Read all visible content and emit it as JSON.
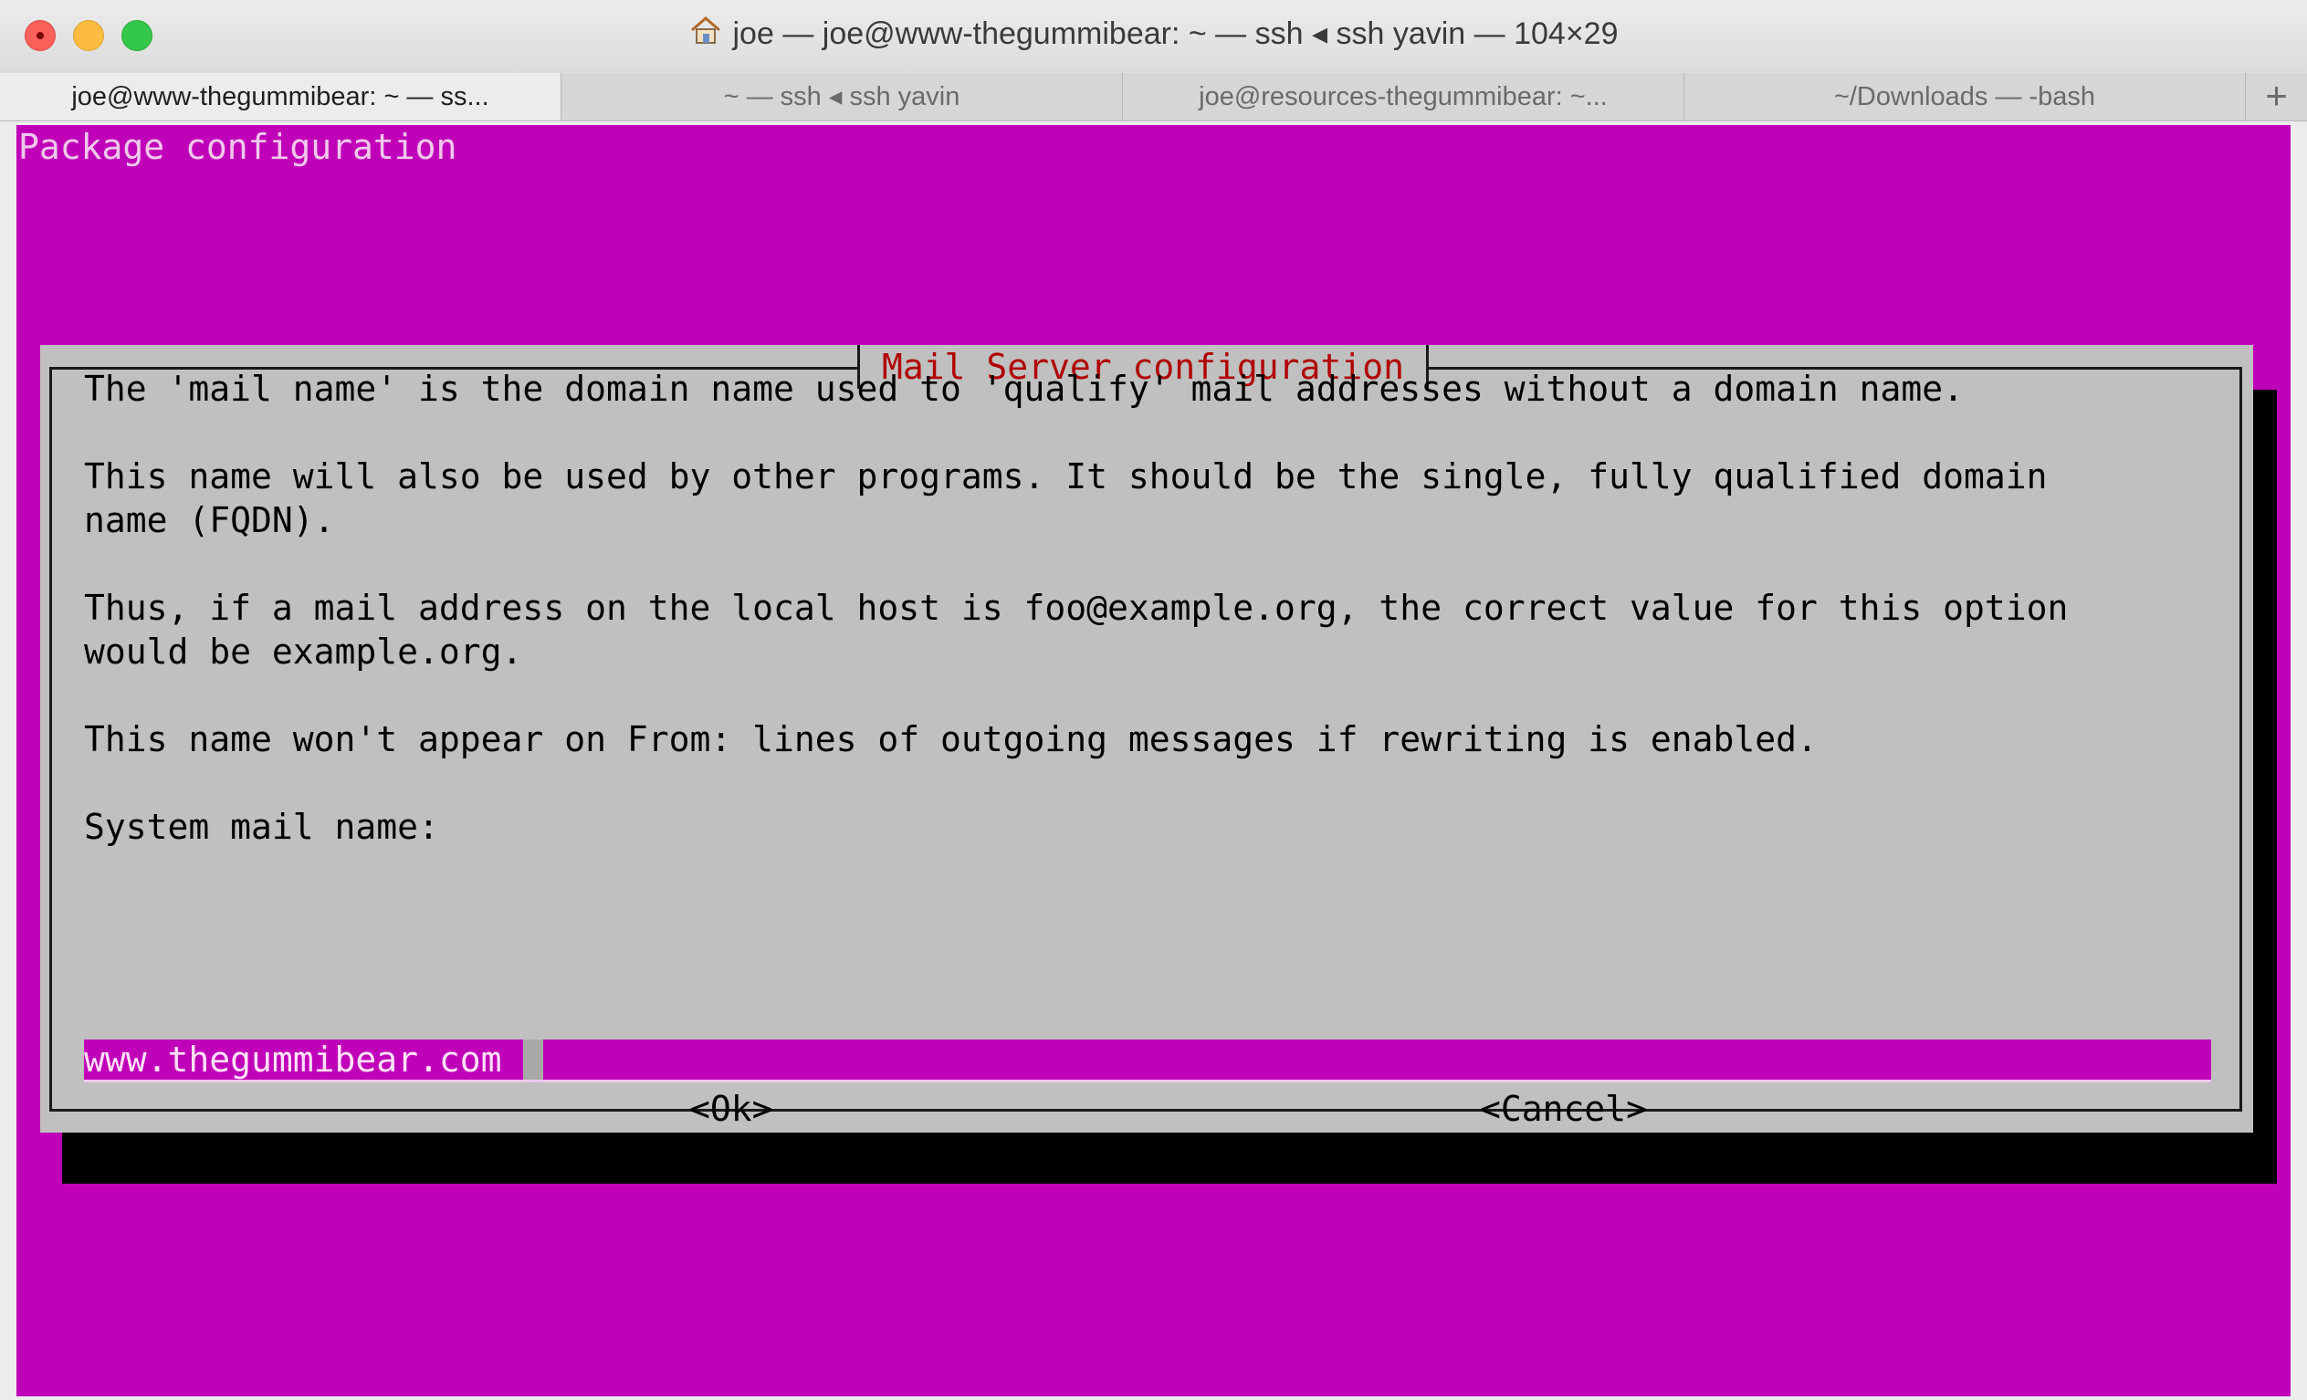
{
  "window": {
    "title": "joe — joe@www-thegummibear: ~ — ssh ◂ ssh yavin — 104×29"
  },
  "tabs": [
    {
      "label": "joe@www-thegummibear: ~ — ss...",
      "active": true
    },
    {
      "label": "~ — ssh ◂ ssh yavin",
      "active": false
    },
    {
      "label": "joe@resources-thegummibear: ~...",
      "active": false
    },
    {
      "label": "~/Downloads — -bash",
      "active": false
    }
  ],
  "tab_add_label": "+",
  "terminal": {
    "package_title": "Package configuration",
    "dialog": {
      "title": "Mail Server configuration",
      "lines": [
        "The 'mail name' is the domain name used to 'qualify' mail addresses without a domain name.",
        "This name will also be used by other programs. It should be the single, fully qualified domain",
        "name (FQDN).",
        "Thus, if a mail address on the local host is foo@example.org, the correct value for this option",
        "would be example.org.",
        "This name won't appear on From: lines of outgoing messages if rewriting is enabled.",
        "System mail name:"
      ],
      "input_value": "www.thegummibear.com",
      "ok_label": "<Ok>",
      "cancel_label": "<Cancel>"
    }
  },
  "colors": {
    "terminal_bg": "#c000b8",
    "dialog_bg": "#c0c0c0",
    "dialog_title": "#b00000"
  }
}
